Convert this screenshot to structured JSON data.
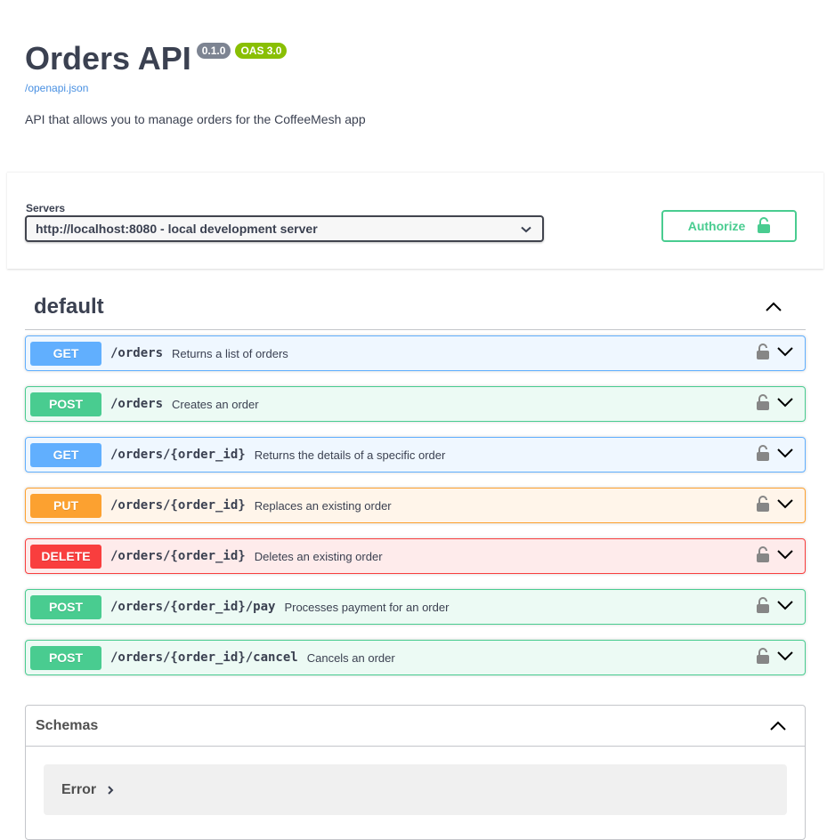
{
  "info": {
    "title": "Orders API",
    "version": "0.1.0",
    "oas_badge": "OAS 3.0",
    "spec_link": "/openapi.json",
    "description": "API that allows you to manage orders for the CoffeeMesh app"
  },
  "servers": {
    "label": "Servers",
    "selected": "http://localhost:8080 - local development server"
  },
  "authorize": {
    "label": "Authorize",
    "icon": "unlocked-padlock-icon"
  },
  "tag": {
    "name": "default",
    "expanded": true
  },
  "operations": [
    {
      "method": "GET",
      "path": "/orders",
      "summary": "Returns a list of orders"
    },
    {
      "method": "POST",
      "path": "/orders",
      "summary": "Creates an order"
    },
    {
      "method": "GET",
      "path": "/orders/{order_id}",
      "summary": "Returns the details of a specific order"
    },
    {
      "method": "PUT",
      "path": "/orders/{order_id}",
      "summary": "Replaces an existing order"
    },
    {
      "method": "DELETE",
      "path": "/orders/{order_id}",
      "summary": "Deletes an existing order"
    },
    {
      "method": "POST",
      "path": "/orders/{order_id}/pay",
      "summary": "Processes payment for an order"
    },
    {
      "method": "POST",
      "path": "/orders/{order_id}/cancel",
      "summary": "Cancels an order"
    }
  ],
  "schemas": {
    "title": "Schemas",
    "models": [
      {
        "name": "Error"
      }
    ]
  },
  "colors": {
    "get": "#61affe",
    "post": "#49cc90",
    "put": "#fca130",
    "delete": "#f93e3e",
    "version_badge": "#7d8492",
    "oas_badge": "#89bf04",
    "link": "#4990e2"
  }
}
